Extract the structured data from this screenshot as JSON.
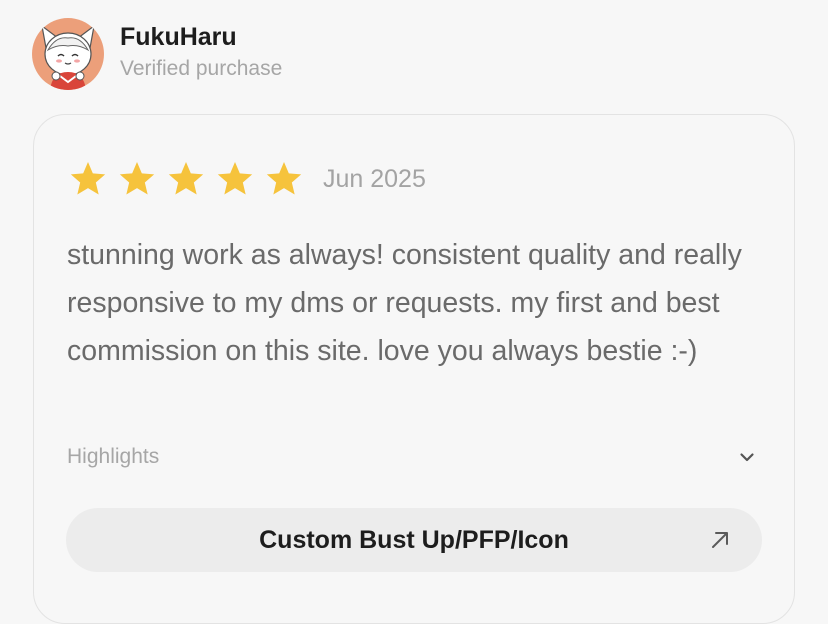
{
  "review": {
    "author": {
      "name": "FukuHaru",
      "status": "Verified purchase",
      "avatar_icon": "anime-character-avatar"
    },
    "rating": {
      "stars": 5,
      "max": 5,
      "star_color": "#f6c33c",
      "star_icon": "star-icon"
    },
    "date": "Jun 2025",
    "text": "stunning work as always! consistent quality and really responsive to my dms or requests. my first and best commission on this site. love you always bestie :-)",
    "highlights": {
      "label": "Highlights",
      "icon": "chevron-down-icon"
    },
    "product": {
      "label": "Custom Bust Up/PFP/Icon",
      "icon": "arrow-up-right-icon"
    }
  }
}
